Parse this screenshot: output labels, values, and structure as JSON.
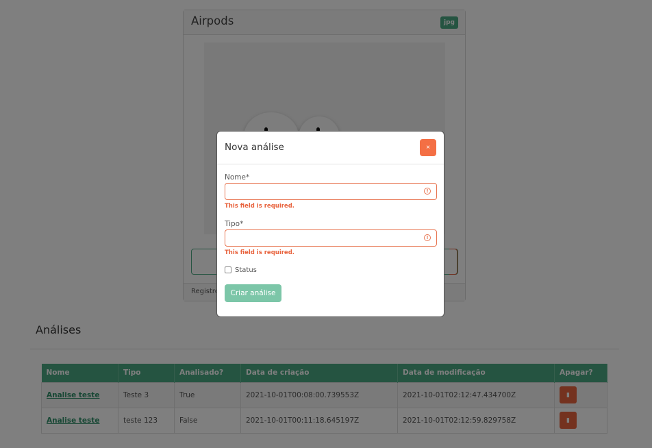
{
  "card": {
    "title": "Airpods",
    "badge": "jpg",
    "footer_text": "Registro"
  },
  "analyses": {
    "title": "Análises",
    "columns": [
      "Nome",
      "Tipo",
      "Analisado?",
      "Data de criação",
      "Data de modificação",
      "Apagar?"
    ],
    "rows": [
      {
        "nome": "Analise teste",
        "tipo": "Teste 3",
        "analisado": "True",
        "criacao": "2021-10-01T00:08:00.739553Z",
        "modificacao": "2021-10-01T02:12:47.434700Z"
      },
      {
        "nome": "Analise teste",
        "tipo": "teste 123",
        "analisado": "False",
        "criacao": "2021-10-01T00:11:18.645197Z",
        "modificacao": "2021-10-01T02:12:59.829758Z"
      }
    ],
    "delete_icon": "trash-icon"
  },
  "modal": {
    "title": "Nova análise",
    "close_label": "×",
    "fields": {
      "nome": {
        "label": "Nome*",
        "value": "",
        "error": "This field is required."
      },
      "tipo": {
        "label": "Tipo*",
        "value": "",
        "error": "This field is required."
      }
    },
    "status": {
      "label": "Status",
      "checked": false
    },
    "submit_label": "Criar análise"
  },
  "colors": {
    "primary": "#4aa883",
    "danger": "#e8643f",
    "submit": "#7cc6a8"
  }
}
